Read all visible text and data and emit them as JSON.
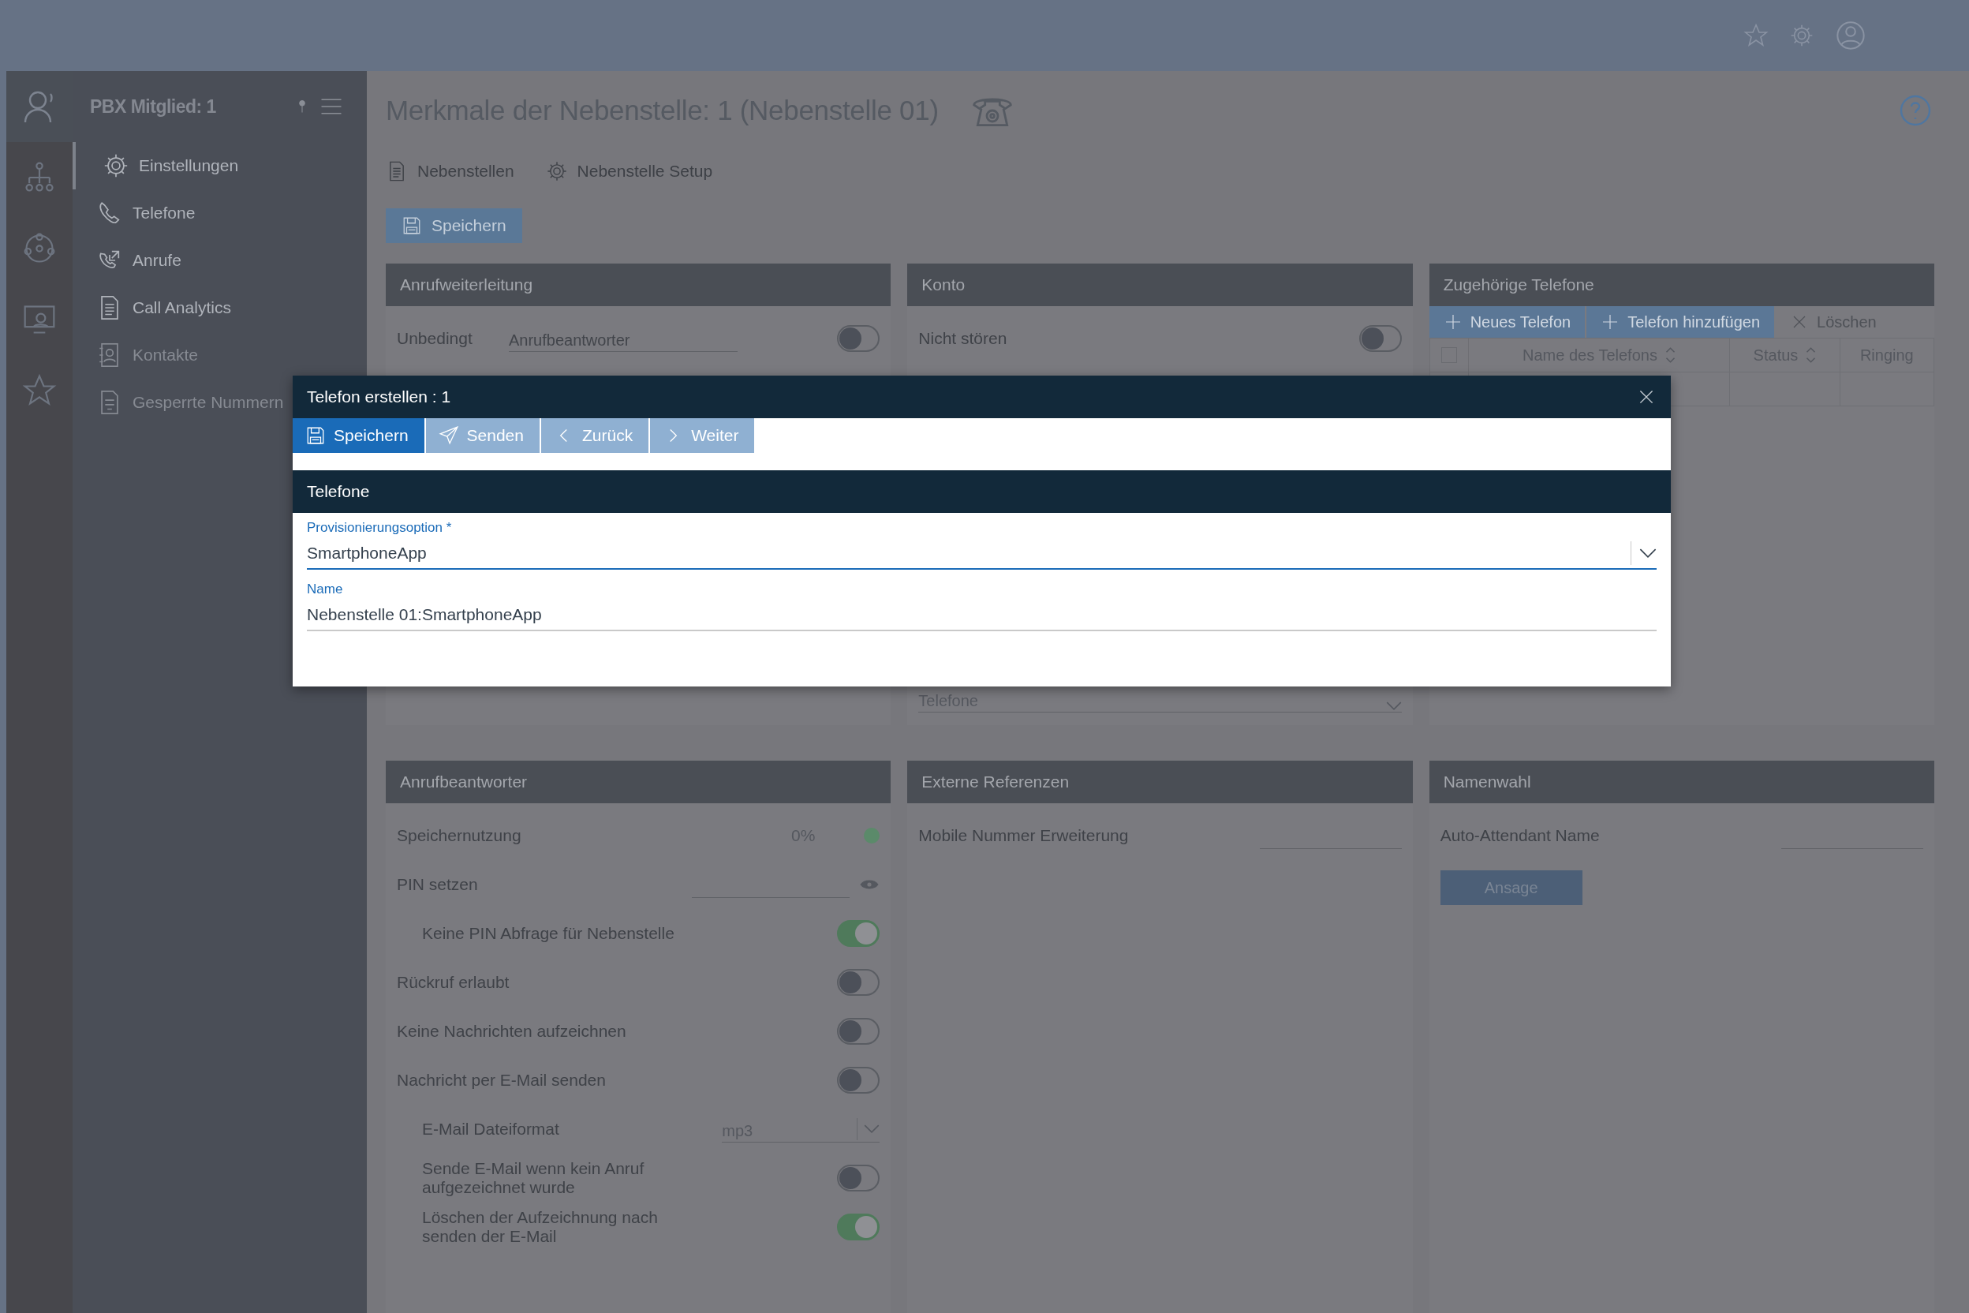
{
  "sidebar": {
    "title": "PBX Mitglied: 1",
    "items": [
      {
        "label": "Einstellungen",
        "selected": true,
        "disabled": false
      },
      {
        "label": "Telefone",
        "selected": false,
        "disabled": false
      },
      {
        "label": "Anrufe",
        "selected": false,
        "disabled": false
      },
      {
        "label": "Call Analytics",
        "selected": false,
        "disabled": false
      },
      {
        "label": "Kontakte",
        "selected": false,
        "disabled": true
      },
      {
        "label": "Gesperrte Nummern",
        "selected": false,
        "disabled": true
      }
    ]
  },
  "page": {
    "title": "Merkmale der Nebenstelle: 1 (Nebenstelle 01)",
    "tabs": [
      {
        "label": "Nebenstellen"
      },
      {
        "label": "Nebenstelle Setup"
      }
    ],
    "save_button": "Speichern"
  },
  "panels": [
    {
      "title": "Anrufweiterleitung",
      "rows": [
        {
          "kind": "fieldtoggle",
          "label": "Unbedingt",
          "placeholder": "Anrufbeantworter",
          "on": false
        }
      ]
    },
    {
      "title": "Konto",
      "rows": [
        {
          "kind": "toggle",
          "label": "Nicht stören",
          "on": false
        },
        {
          "kind": "lowselect",
          "value": "Telefone"
        }
      ]
    },
    {
      "title": "Zugehörige Telefone",
      "rows": [
        {
          "kind": "table",
          "all_checked": false,
          "buttons": [
            {
              "label": "Neues Telefon",
              "disabled": false
            },
            {
              "label": "Telefon hinzufügen",
              "disabled": false
            },
            {
              "label": "Löschen",
              "disabled": true
            }
          ],
          "columns": [
            {
              "label": "Name des Telefons",
              "sortable": true
            },
            {
              "label": "Status",
              "sortable": true
            },
            {
              "label": "Ringing",
              "sortable": false
            }
          ]
        }
      ]
    },
    {
      "title": "Anrufbeantworter",
      "rows": [
        {
          "kind": "meter",
          "label": "Speichernutzung",
          "reading": "0%"
        },
        {
          "kind": "password",
          "label": "PIN setzen",
          "children": [
            {
              "kind": "toggle",
              "label": "Keine PIN Abfrage für Nebenstelle",
              "on": true
            }
          ]
        },
        {
          "kind": "toggle",
          "label": "Rückruf erlaubt",
          "on": false
        },
        {
          "kind": "toggle",
          "label": "Keine Nachrichten aufzeichnen",
          "on": false
        },
        {
          "kind": "toggle",
          "label": "Nachricht per E-Mail senden",
          "on": false,
          "children": [
            {
              "kind": "select",
              "label": "E-Mail Dateiformat",
              "value": "mp3"
            },
            {
              "kind": "toggle",
              "label": "Sende E-Mail wenn kein Anruf aufgezeichnet wurde",
              "on": false
            },
            {
              "kind": "toggle",
              "label": "Löschen der Aufzeichnung nach senden der E-Mail",
              "on": true
            }
          ]
        }
      ]
    },
    {
      "title": "Externe Referenzen",
      "rows": [
        {
          "kind": "text",
          "label": "Mobile Nummer Erweiterung"
        }
      ]
    },
    {
      "title": "Namenwahl",
      "rows": [
        {
          "kind": "text",
          "label": "Auto-Attendant Name"
        },
        {
          "kind": "button",
          "label": "Ansage"
        }
      ]
    }
  ],
  "dialog": {
    "title": "Telefon erstellen : 1",
    "buttons": [
      {
        "label": "Speichern",
        "disabled": false
      },
      {
        "label": "Senden",
        "disabled": true
      },
      {
        "label": "Zurück",
        "disabled": true
      },
      {
        "label": "Weiter",
        "disabled": true
      }
    ],
    "section": "Telefone",
    "fields": [
      {
        "kind": "select",
        "label": "Provisionierungsoption *",
        "value": "SmartphoneApp",
        "focused": true
      },
      {
        "kind": "text",
        "label": "Name",
        "value": "Nebenstelle 01:SmartphoneApp",
        "focused": false
      }
    ]
  }
}
